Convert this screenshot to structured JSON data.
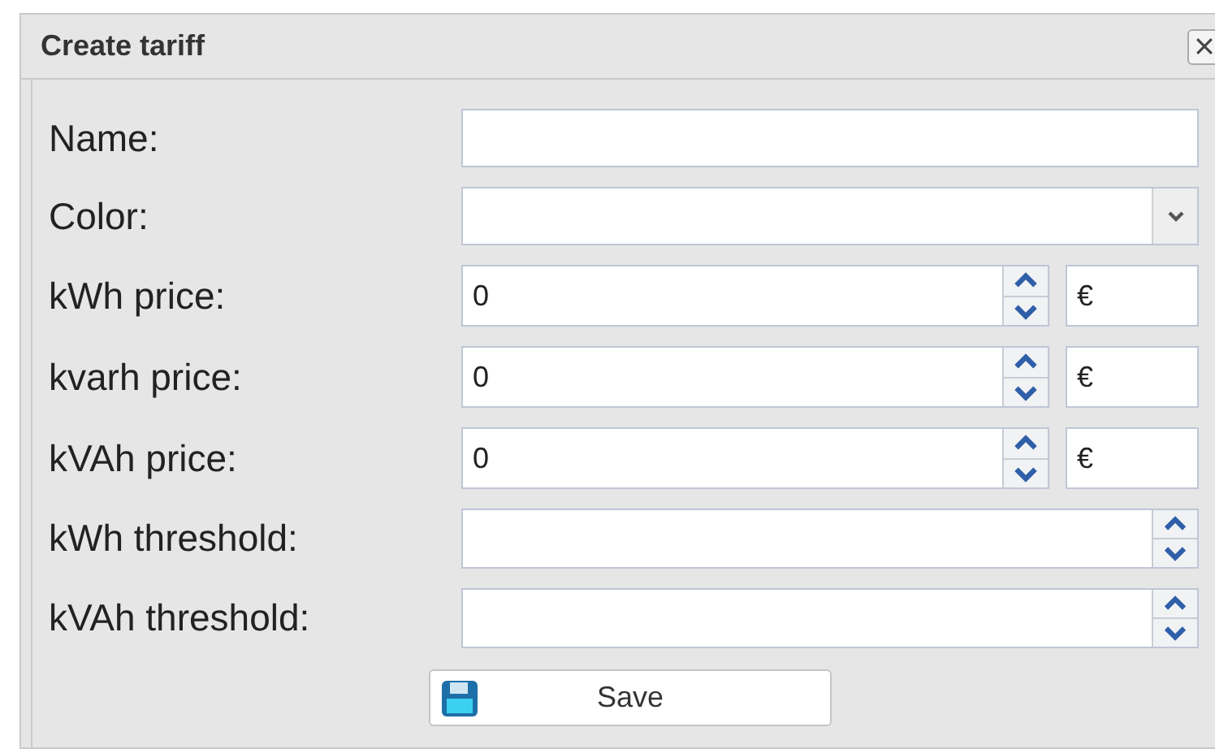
{
  "dialog": {
    "title": "Create tariff"
  },
  "fields": [
    {
      "kind": "text",
      "label": "Name:"
    },
    {
      "kind": "select",
      "label": "Color:"
    },
    {
      "kind": "price",
      "label": "kWh price:",
      "value": "0",
      "currency": "€"
    },
    {
      "kind": "price",
      "label": "kvarh price:",
      "value": "0",
      "currency": "€"
    },
    {
      "kind": "price",
      "label": "kVAh price:",
      "value": "0",
      "currency": "€"
    },
    {
      "kind": "number",
      "label": "kWh threshold:"
    },
    {
      "kind": "number",
      "label": "kVAh threshold:"
    }
  ],
  "save_button": {
    "label": "Save"
  }
}
